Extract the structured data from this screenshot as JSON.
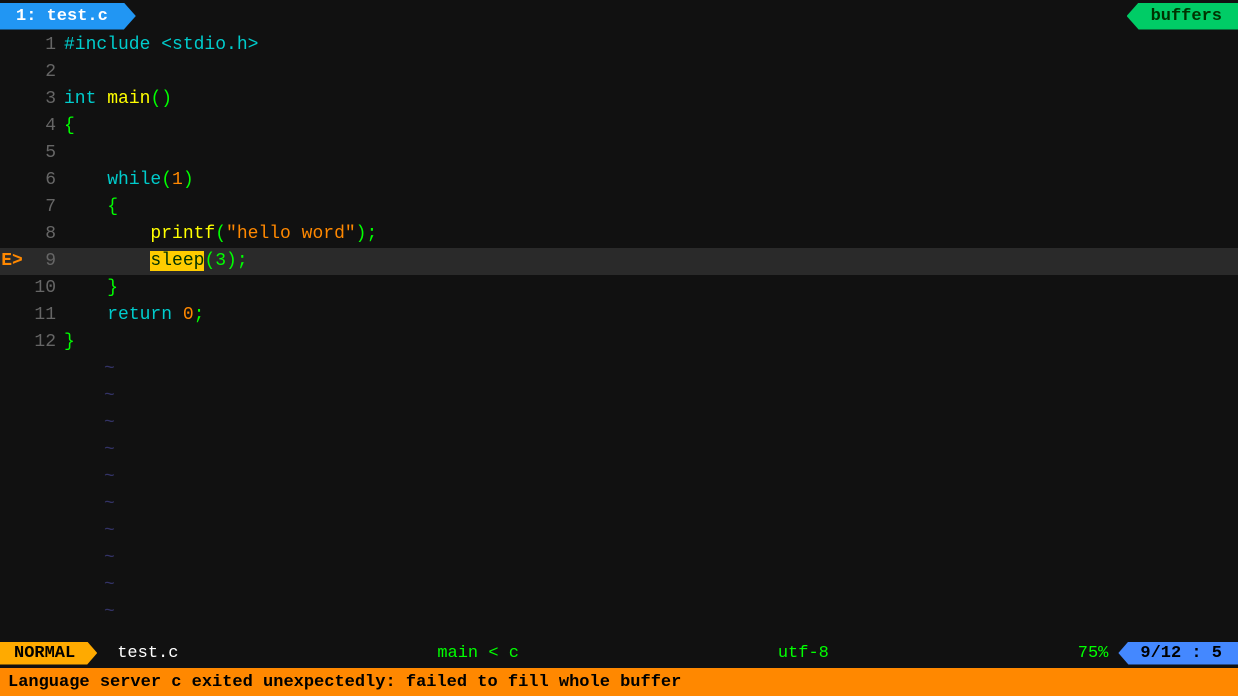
{
  "tab": {
    "number": "1",
    "filename": "test.c",
    "label": "1: test.c"
  },
  "buffers_btn": "buffers",
  "code": {
    "lines": [
      {
        "num": 1,
        "content_html": "<span class=\"c-preprocessor\">#include &lt;stdio.h&gt;</span>",
        "active": false,
        "indicator": ""
      },
      {
        "num": 2,
        "content_html": "",
        "active": false,
        "indicator": ""
      },
      {
        "num": 3,
        "content_html": "<span class=\"c-type\">int</span> <span class=\"c-function\">main</span><span class=\"c-normal\">()</span>",
        "active": false,
        "indicator": ""
      },
      {
        "num": 4,
        "content_html": "<span class=\"c-brace\">{</span>",
        "active": false,
        "indicator": ""
      },
      {
        "num": 5,
        "content_html": "",
        "active": false,
        "indicator": ""
      },
      {
        "num": 6,
        "content_html": "    <span class=\"c-keyword\">while</span><span class=\"c-normal\">(</span><span class=\"c-number\">1</span><span class=\"c-normal\">)</span>",
        "active": false,
        "indicator": ""
      },
      {
        "num": 7,
        "content_html": "    <span class=\"c-brace\">{</span>",
        "active": false,
        "indicator": ""
      },
      {
        "num": 8,
        "content_html": "        <span class=\"c-function\">printf</span><span class=\"c-normal\">(</span><span class=\"c-string\">\"hello word\"</span><span class=\"c-normal\">);</span>",
        "active": false,
        "indicator": ""
      },
      {
        "num": 9,
        "content_html": "        <span class=\"sleep-highlight\">sleep</span><span class=\"c-normal\">(3);</span>",
        "active": true,
        "indicator": "E>"
      },
      {
        "num": 10,
        "content_html": "    <span class=\"c-brace\">}</span>",
        "active": false,
        "indicator": ""
      },
      {
        "num": 11,
        "content_html": "    <span class=\"c-keyword\">return</span> <span class=\"c-number\">0</span><span class=\"c-normal\">;</span>",
        "active": false,
        "indicator": ""
      },
      {
        "num": 12,
        "content_html": "<span class=\"c-brace\">}</span>",
        "active": false,
        "indicator": ""
      }
    ],
    "tildes": 10
  },
  "status": {
    "mode": "NORMAL",
    "filename": "test.c",
    "context": "main  <  c",
    "encoding": "utf-8",
    "position": "9/12  :  5",
    "zoom": "75%"
  },
  "error_bar": {
    "message": "Language server c exited unexpectedly: failed to fill whole buffer"
  }
}
